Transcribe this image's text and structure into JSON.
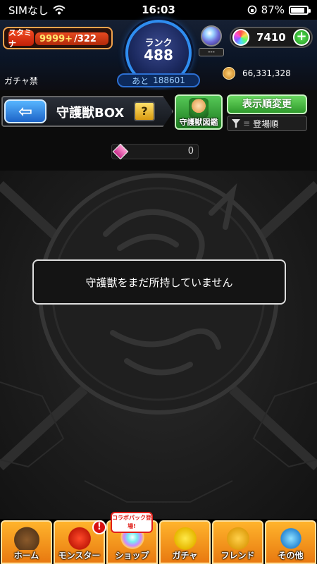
{
  "status_bar": {
    "carrier": "SIMなし",
    "time": "16:03",
    "battery_percent": "87%",
    "battery_level": 0.87
  },
  "header": {
    "stamina_tag": "スタミナ",
    "stamina_current": "9999+",
    "stamina_max": "/322",
    "rank_label": "ランク",
    "rank_value": "488",
    "rank_next_prefix": "あと",
    "rank_next_value": "188601",
    "orb_slot_label": "---",
    "orbs": "7410",
    "gacha_ban": "ガチャ禁",
    "gold": "66,331,328"
  },
  "titlebar": {
    "title": "守護獣BOX",
    "help": "?",
    "encyclopedia_label": "守護獣図鑑",
    "sort_button": "表示順変更",
    "sort_mode": "登場順"
  },
  "count": {
    "value": "0"
  },
  "main": {
    "empty_message": "守護獣をまだ所持していません"
  },
  "bottom_nav": {
    "home": "ホーム",
    "monster": "モンスター",
    "shop": "ショップ",
    "collab_tag": "コラボパック登場!",
    "gacha": "ガチャ",
    "friend": "フレンド",
    "other": "その他",
    "alert": "!"
  },
  "colors": {
    "accent_orange": "#f28c1e",
    "rank_blue": "#2f8df0",
    "sort_green": "#3fb83a"
  }
}
